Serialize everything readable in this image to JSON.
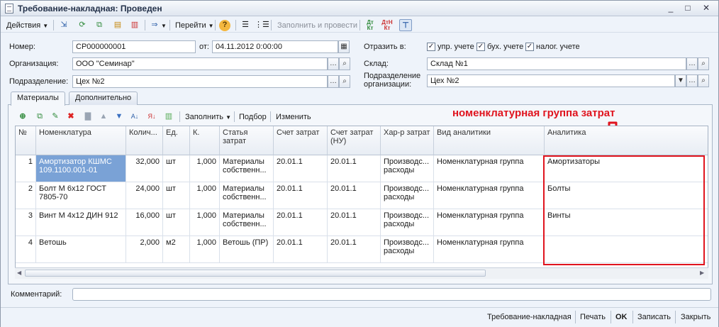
{
  "window": {
    "title": "Требование-накладная: Проведен",
    "minimize": "_",
    "maximize": "□",
    "close": "✕"
  },
  "toolbar": {
    "actions": "Действия",
    "goto": "Перейти",
    "help": "?",
    "fill_post": "Заполнить и провести",
    "dt_kt": "Дт Кт",
    "dtn_kt": "ДтН Кт"
  },
  "form": {
    "number_label": "Номер:",
    "number_value": "СР000000001",
    "from_label": "от:",
    "date_value": "04.11.2012  0:00:00",
    "reflect_label": "Отразить в:",
    "upr_label": "упр. учете",
    "buh_label": "бух. учете",
    "nalog_label": "налог. учете",
    "org_label": "Организация:",
    "org_value": "ООО \"Семинар\"",
    "sklad_label": "Склад:",
    "sklad_value": "Склад №1",
    "podr_label": "Подразделение:",
    "podr_value": "Цех №2",
    "podr_org_label_1": "Подразделение",
    "podr_org_label_2": "организации:",
    "podr_org_value": "Цех №2"
  },
  "tabs": [
    "Материалы",
    "Дополнительно"
  ],
  "grid_toolbar": {
    "fill": "Заполнить",
    "pick": "Подбор",
    "change": "Изменить"
  },
  "columns": {
    "n": "№",
    "nom": "Номенклатура",
    "qty": "Колич...",
    "unit": "Ед.",
    "k": "К.",
    "article": "Статья затрат",
    "acc": "Счет затрат",
    "acc_nu": "Счет затрат (НУ)",
    "char": "Хар-р затрат",
    "analytic_type": "Вид аналитики",
    "analytic": "Аналитика"
  },
  "rows": [
    {
      "n": "1",
      "nom": "Амортизатор КШМС 109.1100.001-01",
      "qty": "32,000",
      "unit": "шт",
      "k": "1,000",
      "article": "Материалы собственн...",
      "acc": "20.01.1",
      "acc_nu": "20.01.1",
      "char": "Производс... расходы",
      "analytic_type": "Номенклатурная группа",
      "analytic": "Амортизаторы"
    },
    {
      "n": "2",
      "nom": "Болт М 6х12 ГОСТ 7805-70",
      "qty": "24,000",
      "unit": "шт",
      "k": "1,000",
      "article": "Материалы собственн...",
      "acc": "20.01.1",
      "acc_nu": "20.01.1",
      "char": "Производс... расходы",
      "analytic_type": "Номенклатурная группа",
      "analytic": "Болты"
    },
    {
      "n": "3",
      "nom": "Винт М 4х12 ДИН 912",
      "qty": "16,000",
      "unit": "шт",
      "k": "1,000",
      "article": "Материалы собственн...",
      "acc": "20.01.1",
      "acc_nu": "20.01.1",
      "char": "Производс... расходы",
      "analytic_type": "Номенклатурная группа",
      "analytic": "Винты"
    },
    {
      "n": "4",
      "nom": "Ветошь",
      "qty": "2,000",
      "unit": "м2",
      "k": "1,000",
      "article": "Ветошь (ПР)",
      "acc": "20.01.1",
      "acc_nu": "20.01.1",
      "char": "Производс... расходы",
      "analytic_type": "Номенклатурная группа",
      "analytic": ""
    }
  ],
  "annotation": "номенклатурная группа затрат",
  "comment_label": "Комментарий:",
  "comment_value": "",
  "bottom": {
    "print_form": "Требование-накладная",
    "print": "Печать",
    "ok": "OK",
    "save": "Записать",
    "close": "Закрыть"
  },
  "colors": {
    "accent_red": "#e0141e",
    "selected_cell": "#7aa2d6"
  }
}
